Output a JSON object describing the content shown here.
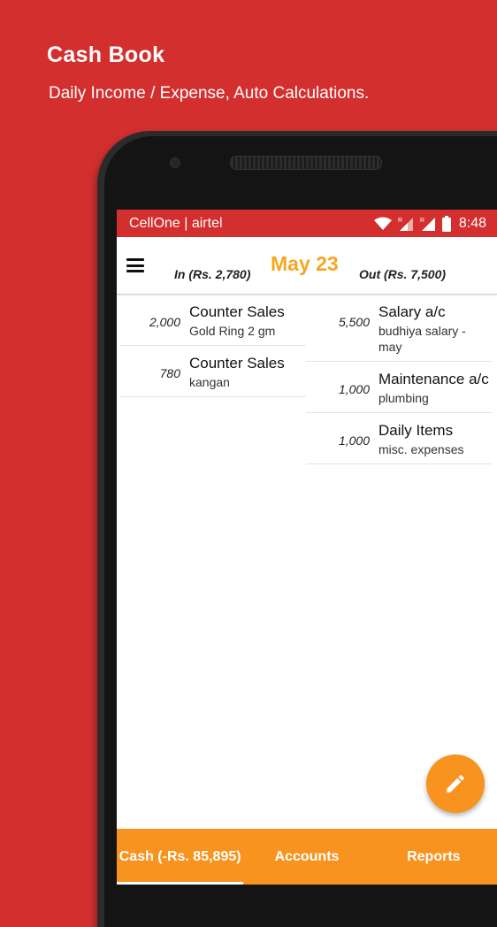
{
  "promo": {
    "title": "Cash Book",
    "subtitle": "Daily Income / Expense, Auto Calculations."
  },
  "status_bar": {
    "carrier": "CellOne | airtel",
    "time": "8:48",
    "icons": [
      "wifi-icon",
      "signal-icon",
      "signal-icon",
      "battery-icon"
    ]
  },
  "toolbar": {
    "in_total": "In (Rs. 2,780)",
    "date": "May 23",
    "out_total": "Out (Rs. 7,500)",
    "menu_icon": "hamburger-menu-icon"
  },
  "income_entries": [
    {
      "amount": "2,000",
      "account": "Counter Sales",
      "description": "Gold Ring 2 gm"
    },
    {
      "amount": "780",
      "account": "Counter Sales",
      "description": "kangan"
    }
  ],
  "expense_entries": [
    {
      "amount": "5,500",
      "account": "Salary a/c",
      "description": "budhiya salary - may"
    },
    {
      "amount": "1,000",
      "account": "Maintenance a/c",
      "description": "plumbing"
    },
    {
      "amount": "1,000",
      "account": "Daily Items",
      "description": "misc. expenses"
    }
  ],
  "fab_icon": "pencil-icon",
  "bottom_nav": {
    "tabs": [
      {
        "label": "Cash (-Rs. 85,895)",
        "active": true
      },
      {
        "label": "Accounts",
        "active": false
      },
      {
        "label": "Reports",
        "active": false
      }
    ]
  },
  "colors": {
    "background": "#d32f2f",
    "accent": "#f7931e",
    "date": "#f5a623"
  }
}
